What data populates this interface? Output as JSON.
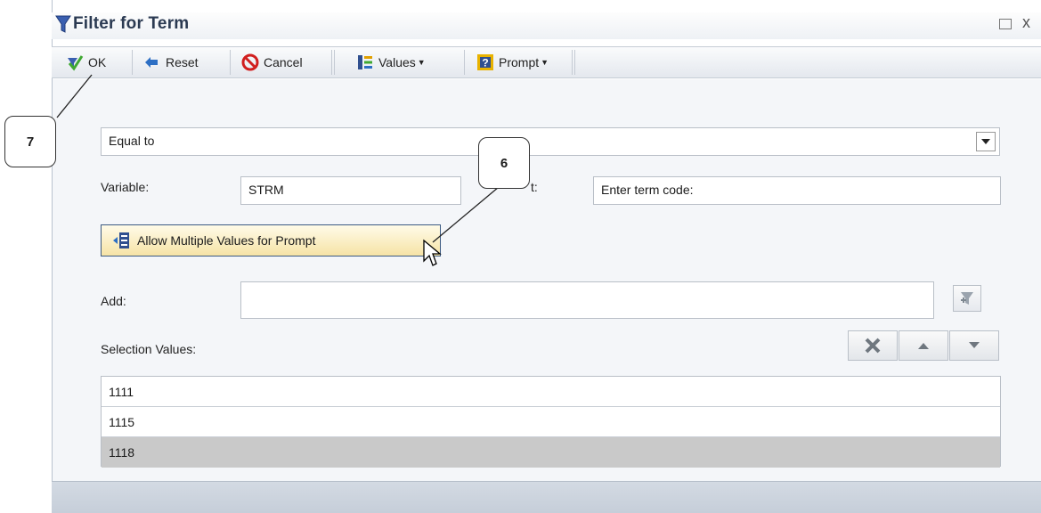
{
  "window": {
    "title": "Filter for Term"
  },
  "toolbar": {
    "ok_label": "OK",
    "reset_label": "Reset",
    "cancel_label": "Cancel",
    "values_label": "Values",
    "prompt_label": "Prompt"
  },
  "operator": {
    "value": "Equal to"
  },
  "variable": {
    "label": "Variable:",
    "value": "STRM"
  },
  "prompt": {
    "label_suffix": "t:",
    "value": "Enter term code:"
  },
  "allow_multiple_button": {
    "label": "Allow Multiple Values for Prompt"
  },
  "add": {
    "label": "Add:"
  },
  "selection": {
    "label": "Selection Values:",
    "values": [
      {
        "value": "1111",
        "selected": false
      },
      {
        "value": "1115",
        "selected": false
      },
      {
        "value": "1118",
        "selected": true
      }
    ]
  },
  "callouts": [
    {
      "label": "7"
    },
    {
      "label": "6"
    }
  ],
  "colors": {
    "title_text": "#2b3a52",
    "selected_row": "#c9c9c9",
    "highlight_button": "#f6e3a6",
    "accent_blue": "#3b5a82"
  }
}
